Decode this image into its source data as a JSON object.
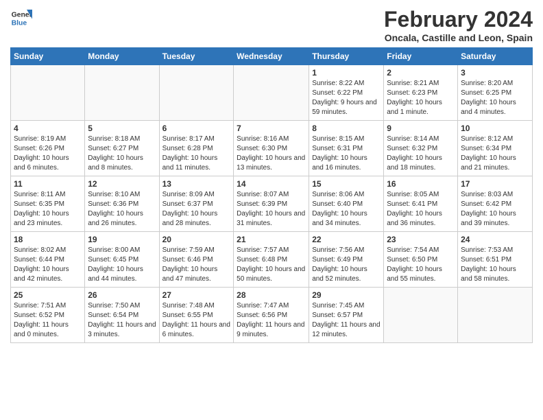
{
  "header": {
    "logo_line1": "General",
    "logo_line2": "Blue",
    "month_year": "February 2024",
    "location": "Oncala, Castille and Leon, Spain"
  },
  "weekdays": [
    "Sunday",
    "Monday",
    "Tuesday",
    "Wednesday",
    "Thursday",
    "Friday",
    "Saturday"
  ],
  "weeks": [
    [
      {
        "day": "",
        "info": ""
      },
      {
        "day": "",
        "info": ""
      },
      {
        "day": "",
        "info": ""
      },
      {
        "day": "",
        "info": ""
      },
      {
        "day": "1",
        "info": "Sunrise: 8:22 AM\nSunset: 6:22 PM\nDaylight: 9 hours and 59 minutes."
      },
      {
        "day": "2",
        "info": "Sunrise: 8:21 AM\nSunset: 6:23 PM\nDaylight: 10 hours and 1 minute."
      },
      {
        "day": "3",
        "info": "Sunrise: 8:20 AM\nSunset: 6:25 PM\nDaylight: 10 hours and 4 minutes."
      }
    ],
    [
      {
        "day": "4",
        "info": "Sunrise: 8:19 AM\nSunset: 6:26 PM\nDaylight: 10 hours and 6 minutes."
      },
      {
        "day": "5",
        "info": "Sunrise: 8:18 AM\nSunset: 6:27 PM\nDaylight: 10 hours and 8 minutes."
      },
      {
        "day": "6",
        "info": "Sunrise: 8:17 AM\nSunset: 6:28 PM\nDaylight: 10 hours and 11 minutes."
      },
      {
        "day": "7",
        "info": "Sunrise: 8:16 AM\nSunset: 6:30 PM\nDaylight: 10 hours and 13 minutes."
      },
      {
        "day": "8",
        "info": "Sunrise: 8:15 AM\nSunset: 6:31 PM\nDaylight: 10 hours and 16 minutes."
      },
      {
        "day": "9",
        "info": "Sunrise: 8:14 AM\nSunset: 6:32 PM\nDaylight: 10 hours and 18 minutes."
      },
      {
        "day": "10",
        "info": "Sunrise: 8:12 AM\nSunset: 6:34 PM\nDaylight: 10 hours and 21 minutes."
      }
    ],
    [
      {
        "day": "11",
        "info": "Sunrise: 8:11 AM\nSunset: 6:35 PM\nDaylight: 10 hours and 23 minutes."
      },
      {
        "day": "12",
        "info": "Sunrise: 8:10 AM\nSunset: 6:36 PM\nDaylight: 10 hours and 26 minutes."
      },
      {
        "day": "13",
        "info": "Sunrise: 8:09 AM\nSunset: 6:37 PM\nDaylight: 10 hours and 28 minutes."
      },
      {
        "day": "14",
        "info": "Sunrise: 8:07 AM\nSunset: 6:39 PM\nDaylight: 10 hours and 31 minutes."
      },
      {
        "day": "15",
        "info": "Sunrise: 8:06 AM\nSunset: 6:40 PM\nDaylight: 10 hours and 34 minutes."
      },
      {
        "day": "16",
        "info": "Sunrise: 8:05 AM\nSunset: 6:41 PM\nDaylight: 10 hours and 36 minutes."
      },
      {
        "day": "17",
        "info": "Sunrise: 8:03 AM\nSunset: 6:42 PM\nDaylight: 10 hours and 39 minutes."
      }
    ],
    [
      {
        "day": "18",
        "info": "Sunrise: 8:02 AM\nSunset: 6:44 PM\nDaylight: 10 hours and 42 minutes."
      },
      {
        "day": "19",
        "info": "Sunrise: 8:00 AM\nSunset: 6:45 PM\nDaylight: 10 hours and 44 minutes."
      },
      {
        "day": "20",
        "info": "Sunrise: 7:59 AM\nSunset: 6:46 PM\nDaylight: 10 hours and 47 minutes."
      },
      {
        "day": "21",
        "info": "Sunrise: 7:57 AM\nSunset: 6:48 PM\nDaylight: 10 hours and 50 minutes."
      },
      {
        "day": "22",
        "info": "Sunrise: 7:56 AM\nSunset: 6:49 PM\nDaylight: 10 hours and 52 minutes."
      },
      {
        "day": "23",
        "info": "Sunrise: 7:54 AM\nSunset: 6:50 PM\nDaylight: 10 hours and 55 minutes."
      },
      {
        "day": "24",
        "info": "Sunrise: 7:53 AM\nSunset: 6:51 PM\nDaylight: 10 hours and 58 minutes."
      }
    ],
    [
      {
        "day": "25",
        "info": "Sunrise: 7:51 AM\nSunset: 6:52 PM\nDaylight: 11 hours and 0 minutes."
      },
      {
        "day": "26",
        "info": "Sunrise: 7:50 AM\nSunset: 6:54 PM\nDaylight: 11 hours and 3 minutes."
      },
      {
        "day": "27",
        "info": "Sunrise: 7:48 AM\nSunset: 6:55 PM\nDaylight: 11 hours and 6 minutes."
      },
      {
        "day": "28",
        "info": "Sunrise: 7:47 AM\nSunset: 6:56 PM\nDaylight: 11 hours and 9 minutes."
      },
      {
        "day": "29",
        "info": "Sunrise: 7:45 AM\nSunset: 6:57 PM\nDaylight: 11 hours and 12 minutes."
      },
      {
        "day": "",
        "info": ""
      },
      {
        "day": "",
        "info": ""
      }
    ]
  ]
}
